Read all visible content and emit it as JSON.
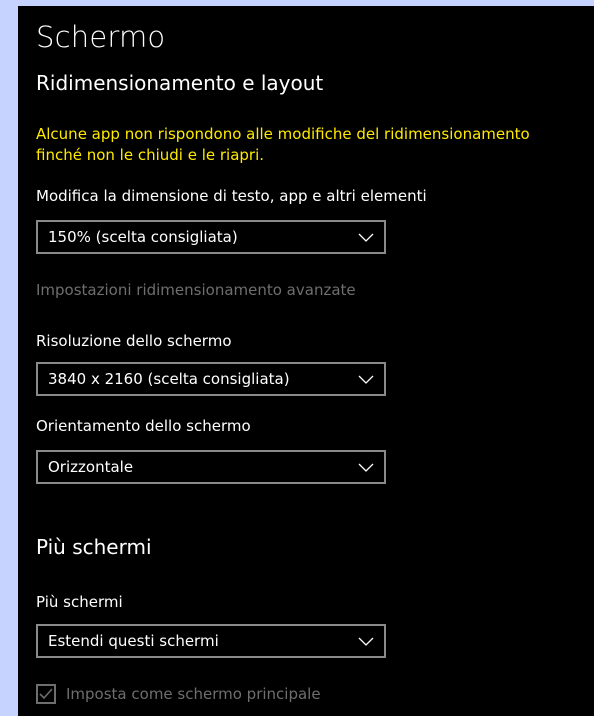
{
  "page": {
    "title": "Schermo"
  },
  "scaling": {
    "section_title": "Ridimensionamento e layout",
    "warning_line1": "Alcune app non rispondono alle modifiche del ridimensionamento",
    "warning_line2": "finché non le chiudi e le riapri.",
    "size_label": "Modifica la dimensione di testo, app e altri elementi",
    "size_value": "150% (scelta consigliata)",
    "advanced_link": "Impostazioni ridimensionamento avanzate",
    "resolution_label": "Risoluzione dello schermo",
    "resolution_value": "3840 x 2160 (scelta consigliata)",
    "orientation_label": "Orientamento dello schermo",
    "orientation_value": "Orizzontale"
  },
  "multi": {
    "section_title": "Più schermi",
    "label": "Più schermi",
    "value": "Estendi questi schermi",
    "checkbox_label": "Imposta come schermo principale",
    "checkbox_checked": true,
    "checkbox_disabled": true
  },
  "colors": {
    "background": "#000000",
    "text": "#ffffff",
    "warning": "#ffea00",
    "disabled": "#6e6e6e",
    "border": "#8a8a8a",
    "outer": "#c7d3ff"
  }
}
